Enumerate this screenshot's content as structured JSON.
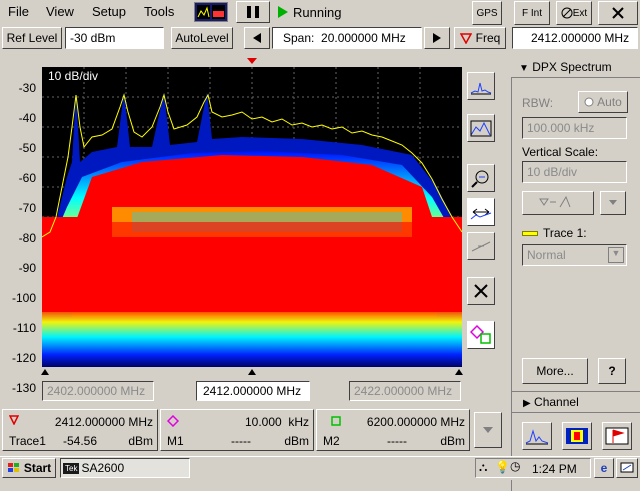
{
  "menu": {
    "file": "File",
    "view": "View",
    "setup": "Setup",
    "tools": "Tools"
  },
  "status": {
    "run_state": "Running"
  },
  "toolbar": {
    "gps": "GPS",
    "fint": "F Int",
    "ext": "Ext"
  },
  "controls": {
    "ref_level_label": "Ref Level",
    "ref_level_value": "-30 dBm",
    "autolevel_label": "AutoLevel",
    "span_label": "Span:",
    "span_value": "20.000000 MHz",
    "freq_label": "Freq",
    "freq_value": "2412.000000 MHz"
  },
  "plot": {
    "scale_label": "10 dB/div",
    "y_ticks": [
      "-30",
      "-40",
      "-50",
      "-60",
      "-70",
      "-80",
      "-90",
      "-100",
      "-110",
      "-120",
      "-130"
    ],
    "x_start": "2402.000000 MHz",
    "x_center": "2412.000000 MHz",
    "x_stop": "2422.000000 MHz"
  },
  "panel": {
    "title": "DPX Spectrum",
    "rbw_label": "RBW:",
    "auto_label": "Auto",
    "rbw_value": "100.000 kHz",
    "vscale_label": "Vertical Scale:",
    "vscale_value": "10 dB/div",
    "trace_label": "Trace 1:",
    "trace_mode": "Normal",
    "more_label": "More...",
    "help_label": "?",
    "channel_label": "Channel"
  },
  "markers": {
    "ref": {
      "freq": "2412.000000 MHz",
      "name": "Trace1",
      "level": "-54.56",
      "unit": "dBm"
    },
    "m1": {
      "freq": "10.000",
      "freq_unit": "kHz",
      "name": "M1",
      "level": "-----",
      "unit": "dBm"
    },
    "m2": {
      "freq": "6200.000000 MHz",
      "name": "M2",
      "level": "-----",
      "unit": "dBm"
    }
  },
  "taskbar": {
    "start": "Start",
    "app": "SA2600",
    "time": "1:24 PM"
  },
  "colors": {
    "accent_red": "#e00000",
    "trace_yellow": "#ffff00",
    "spectrum_red": "#ff0000"
  }
}
